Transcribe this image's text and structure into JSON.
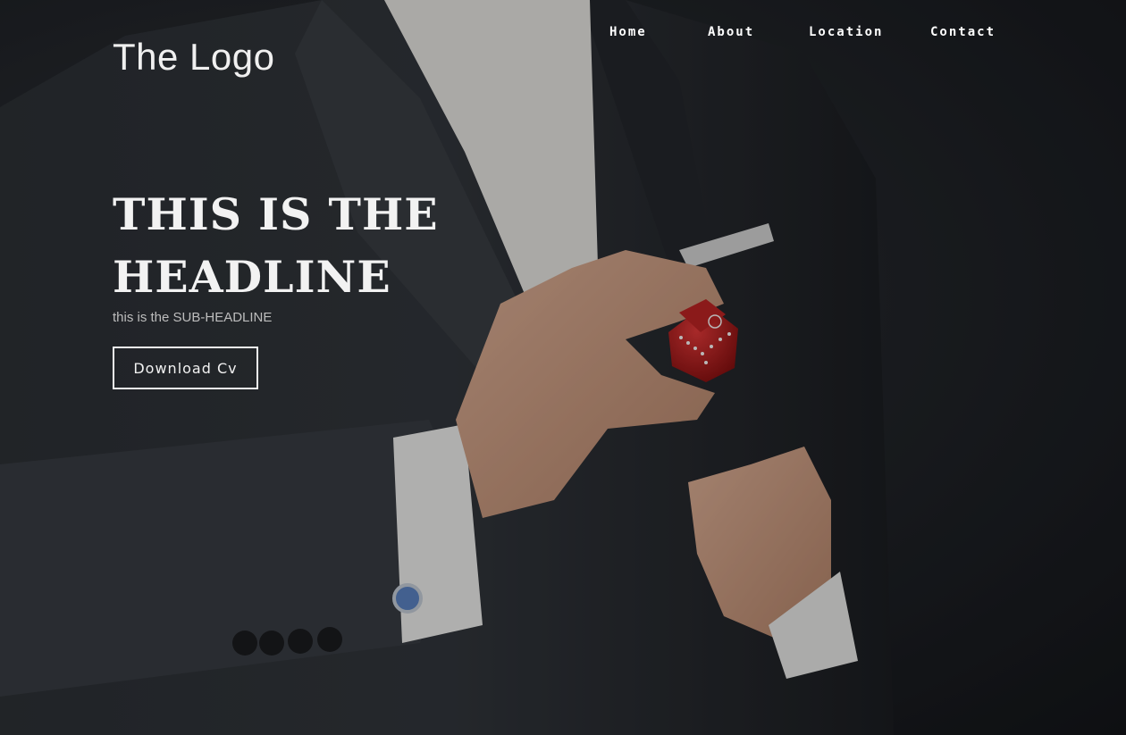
{
  "header": {
    "logo": "The Logo",
    "nav": [
      {
        "label": "Home"
      },
      {
        "label": "About"
      },
      {
        "label": "Location"
      },
      {
        "label": "Contact"
      }
    ]
  },
  "hero": {
    "headline_line1": "THIS IS THE",
    "headline_line2": "HEADLINE",
    "subheadline": "this is the SUB-HEADLINE",
    "cta_label": "Download Cv"
  },
  "colors": {
    "background": "#1a1c20",
    "text": "#f2f2f2",
    "subtext": "#bdbdbd",
    "accent": "#c81e1e"
  }
}
